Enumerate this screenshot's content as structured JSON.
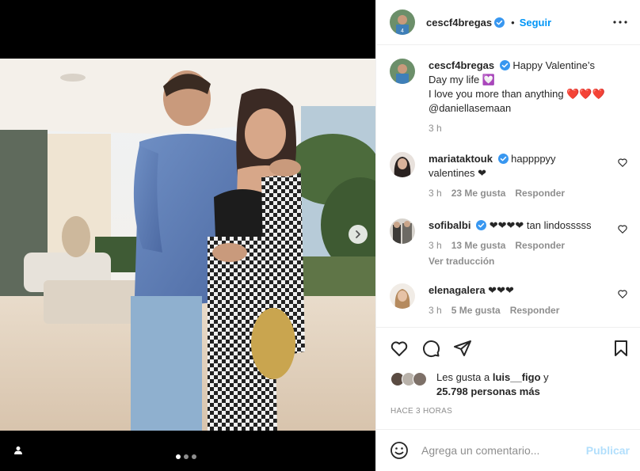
{
  "post": {
    "author": "cescf4bregas",
    "follow_label": "Seguir",
    "separator": "•",
    "caption": {
      "username": "cescf4bregas",
      "text": "Happy Valentine’s Day my life 💟 I love you more than anything ❤️❤️❤️ @daniellasemaan",
      "line1": "Happy Valentine’s",
      "line2": "Day my life 💟",
      "line3": "I love you more than anything ❤️❤️❤️",
      "line4": "@daniellasemaan",
      "time": "3 h"
    },
    "carousel": {
      "current": 1,
      "total": 3
    }
  },
  "comments": [
    {
      "username": "mariataktouk",
      "verified": true,
      "line1": "happppyy",
      "line2": "valentines ❤",
      "time": "3 h",
      "likes": "23 Me gusta",
      "reply": "Responder"
    },
    {
      "username": "sofibalbi",
      "verified": true,
      "text": "❤❤❤❤ tan lindosssss",
      "time": "3 h",
      "likes": "13 Me gusta",
      "reply": "Responder",
      "translate": "Ver traducción"
    },
    {
      "username": "elenagalera",
      "verified": false,
      "text": "❤❤❤",
      "time": "3 h",
      "likes": "5 Me gusta",
      "reply": "Responder"
    }
  ],
  "likes": {
    "prefix": "Les gusta a",
    "user": "luis__figo",
    "connector": "y",
    "count": "25.798 personas más"
  },
  "time_ago": "HACE 3 HORAS",
  "add_comment": {
    "placeholder": "Agrega un comentario...",
    "publish_label": "Publicar"
  },
  "colors": {
    "accent": "#0095f6",
    "verified": "#3897f0",
    "publish_disabled": "#b2dffc",
    "muted": "#8e8e8e"
  },
  "icons": [
    "verified-badge-icon",
    "more-options-icon",
    "heart-icon",
    "comment-icon",
    "share-icon",
    "save-icon",
    "emoji-icon",
    "chevron-right-icon",
    "user-tag-icon"
  ]
}
